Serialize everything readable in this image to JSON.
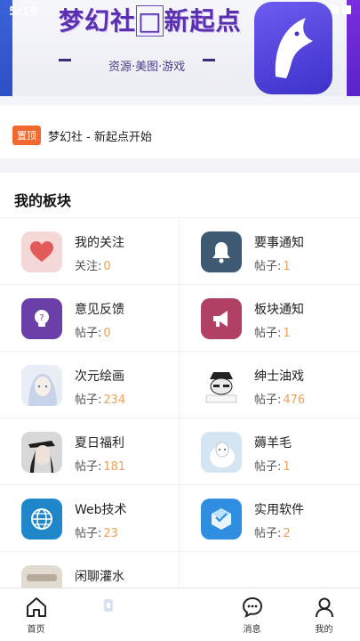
{
  "status": {
    "time": "5:19"
  },
  "banner": {
    "title_a": "梦幻社",
    "title_box": "□",
    "title_b": "新起点",
    "subtitle": "资源·美图·游戏"
  },
  "notice": {
    "badge": "置顶",
    "text": "梦幻社 - 新起点开始"
  },
  "section": {
    "title": "我的板块"
  },
  "boards": [
    {
      "name": "我的关注",
      "stat_label": "关注:",
      "count": "0",
      "icon": "heart-icon",
      "color": "#f5d9d9"
    },
    {
      "name": "要事通知",
      "stat_label": "帖子:",
      "count": "1",
      "icon": "bell-icon",
      "color": "#3d5a72"
    },
    {
      "name": "意见反馈",
      "stat_label": "帖子:",
      "count": "0",
      "icon": "lightbulb-icon",
      "color": "#6a3fa8"
    },
    {
      "name": "板块通知",
      "stat_label": "帖子:",
      "count": "1",
      "icon": "megaphone-icon",
      "color": "#b04064"
    },
    {
      "name": "次元绘画",
      "stat_label": "帖子:",
      "count": "234",
      "icon": "anime-girl-icon",
      "color": "#dfe6f2"
    },
    {
      "name": "绅士油戏",
      "stat_label": "帖子:",
      "count": "476",
      "icon": "meme-face-icon",
      "color": "#f2f2f2"
    },
    {
      "name": "夏日福利",
      "stat_label": "帖子:",
      "count": "181",
      "icon": "girl-photo-icon",
      "color": "#cfcfcf"
    },
    {
      "name": "薅羊毛",
      "stat_label": "帖子:",
      "count": "1",
      "icon": "sheep-icon",
      "color": "#cfe1f0"
    },
    {
      "name": "Web技术",
      "stat_label": "帖子:",
      "count": "23",
      "icon": "globe-icon",
      "color": "#1f86c9"
    },
    {
      "name": "实用软件",
      "stat_label": "帖子:",
      "count": "2",
      "icon": "software-box-icon",
      "color": "#2f8ee0"
    },
    {
      "name": "闲聊灌水",
      "stat_label": "",
      "count": "",
      "icon": "chat-icon",
      "color": "#d9d2c8"
    }
  ],
  "nav": [
    {
      "label": "首页",
      "icon": "home-icon"
    },
    {
      "label": "",
      "icon": "publish-icon"
    },
    {
      "label": "",
      "icon": "blank-icon"
    },
    {
      "label": "消息",
      "icon": "message-icon"
    },
    {
      "label": "我的",
      "icon": "user-icon"
    }
  ]
}
